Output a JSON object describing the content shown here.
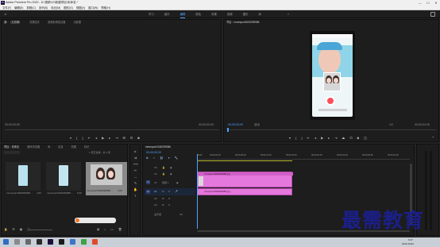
{
  "window": {
    "title": "Adobe Premiere Pro 2020 - D:\\视频\\12\\新建项目\\未命名 *",
    "logo_text": "Pr",
    "controls": [
      "—",
      "☐",
      "✕"
    ]
  },
  "menu": [
    "文件(F)",
    "编辑(E)",
    "剪辑(C)",
    "序列(S)",
    "标记(M)",
    "图形(G)",
    "视图(V)",
    "窗口(W)",
    "帮助(H)"
  ],
  "workspaces": {
    "tabs": [
      "学习",
      "组件",
      "编辑",
      "颜色",
      "效果",
      "音频",
      "图形",
      "库"
    ],
    "active": "编辑",
    "more": "»"
  },
  "source_panel": {
    "tabs": [
      "源：（无剪辑）",
      "效果控件",
      "音频剪辑混合器",
      "元数据"
    ],
    "timecode_left": "00;00;00;00",
    "timecode_right": "00;00;00;00"
  },
  "program_panel": {
    "tab": "节目：mmexport1630299086",
    "timecode": "00;00;00;00",
    "fit": "适合",
    "ratio": "1/2",
    "duration": "00;00;04;26"
  },
  "project_panel": {
    "tabs": [
      "项目：未命名",
      "媒体浏览器",
      "库",
      "信息",
      "效果",
      "标记"
    ],
    "item_count": "1 项已选择，共 3 项",
    "items": [
      {
        "name": "mmexport1630299086...",
        "duration": "4;00"
      },
      {
        "name": "mmexport1630299086...",
        "duration": "5;26"
      },
      {
        "name": "mmexport1630299086...",
        "duration": "4;26"
      }
    ]
  },
  "timeline": {
    "tab": "mmexport1630299086",
    "timecode": "00;00;00;00",
    "ruler": [
      "00;00",
      "00;00;04;00",
      "00;00;08;00",
      "00;00;12;00",
      "00;00;16;00",
      "00;00;20;00",
      "00;00;24;00",
      "00;00;28;00",
      "00;00;32;00"
    ],
    "tracks": [
      {
        "id": "V3",
        "type": "video"
      },
      {
        "id": "V2",
        "type": "video"
      },
      {
        "id": "V1",
        "type": "video",
        "label": "视频 1"
      },
      {
        "id": "A1",
        "type": "audio"
      },
      {
        "id": "A2",
        "type": "audio"
      },
      {
        "id": "A3",
        "type": "audio"
      }
    ],
    "clips": [
      {
        "track": "V1",
        "label": "mmexport1630299086.jpg"
      },
      {
        "track": "A1",
        "label": "mmexport1630299086.jpg"
      }
    ],
    "master": "主声道",
    "master_value": "0.0"
  },
  "watermark": "最需教育",
  "taskbar": {
    "time": "9:47",
    "date": "2021/10/22"
  },
  "colors": {
    "accent": "#4ea3ff",
    "clip": "#e478dc",
    "panel": "#1d1d1d",
    "watermark": "#1b1f8a"
  }
}
